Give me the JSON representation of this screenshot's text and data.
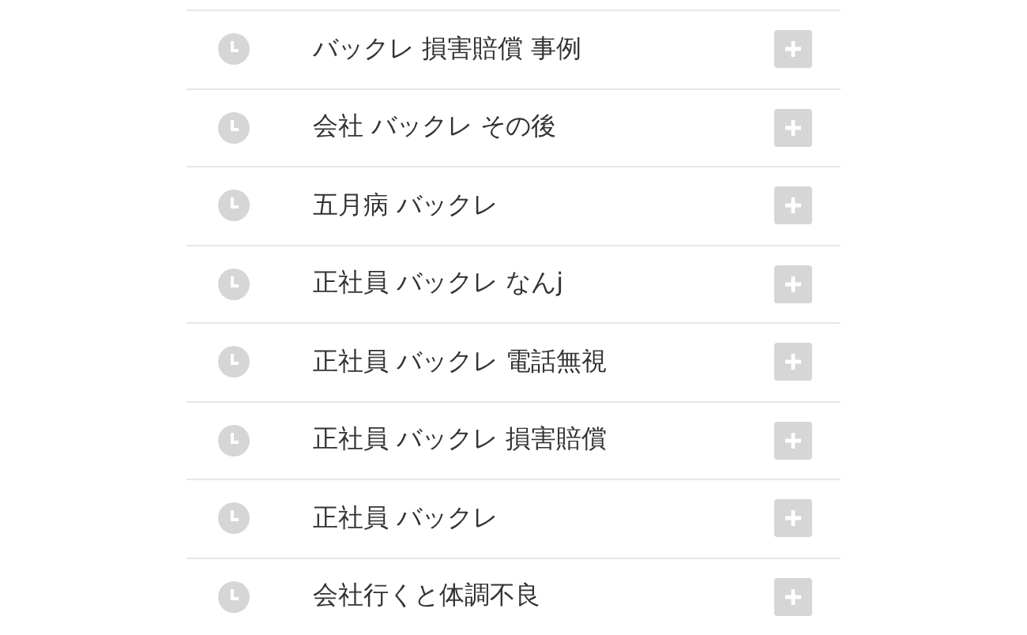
{
  "history": [
    {
      "text": "バックレ 損害賠償 事例"
    },
    {
      "text": "会社 バックレ その後"
    },
    {
      "text": "五月病 バックレ"
    },
    {
      "text": "正社員 バックレ なんj"
    },
    {
      "text": "正社員 バックレ 電話無視"
    },
    {
      "text": "正社員 バックレ 損害賠償"
    },
    {
      "text": "正社員 バックレ"
    },
    {
      "text": "会社行くと体調不良"
    }
  ]
}
